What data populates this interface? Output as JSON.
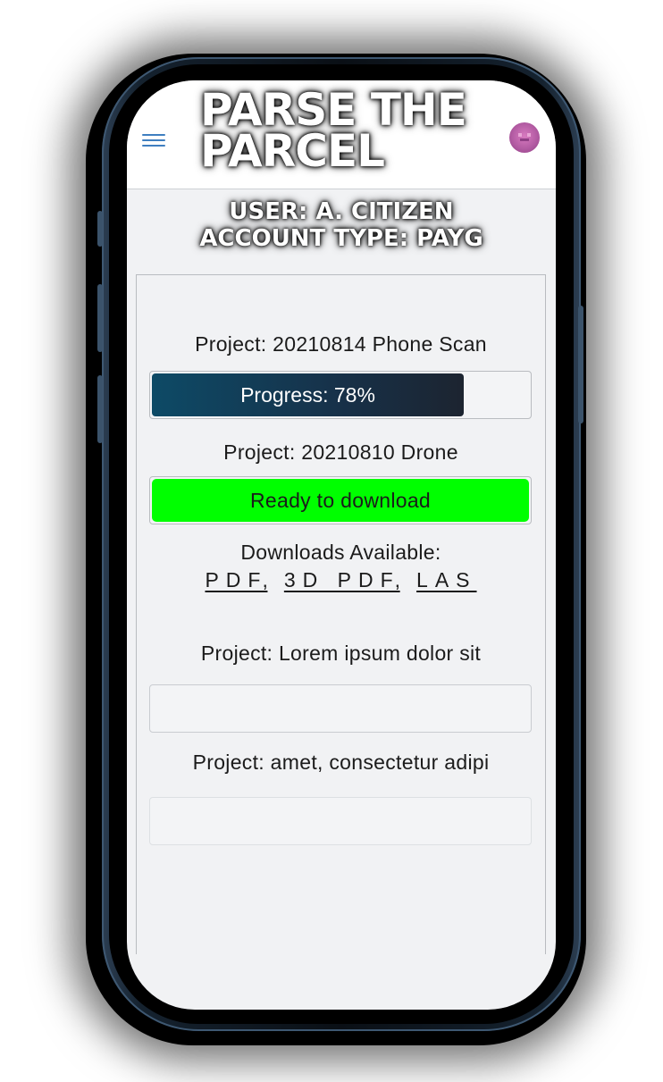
{
  "app": {
    "title": "PARSE THE PARCEL",
    "brand_line1": "PARSE THE",
    "brand_line2": "PARCEL",
    "menu_icon": "hamburger-menu-icon",
    "avatar_icon": "user-avatar-icon"
  },
  "user": {
    "name_line": "USER: A. CITIZEN",
    "account_line": "ACCOUNT TYPE: PAYG"
  },
  "projects": [
    {
      "title": "Project: 20210814 Phone Scan",
      "status": "in-progress",
      "progress": 0.78,
      "progress_label": "Progress: 78%"
    },
    {
      "title": "Project: 20210810 Drone",
      "status": "ready",
      "status_label": "Ready to download",
      "downloads_label": "Downloads Available:",
      "downloads": [
        "PDF",
        "3D PDF",
        "LAS"
      ]
    },
    {
      "title": "Project: Lorem ipsum dolor sit",
      "status": "pending"
    },
    {
      "title": "Project: amet, consectetur adipi",
      "status": "pending"
    }
  ],
  "colors": {
    "accent": "#3f7fc0",
    "progress_fill": "#173149",
    "ready_fill": "#00ff00",
    "screen_bg": "#f1f2f4"
  }
}
